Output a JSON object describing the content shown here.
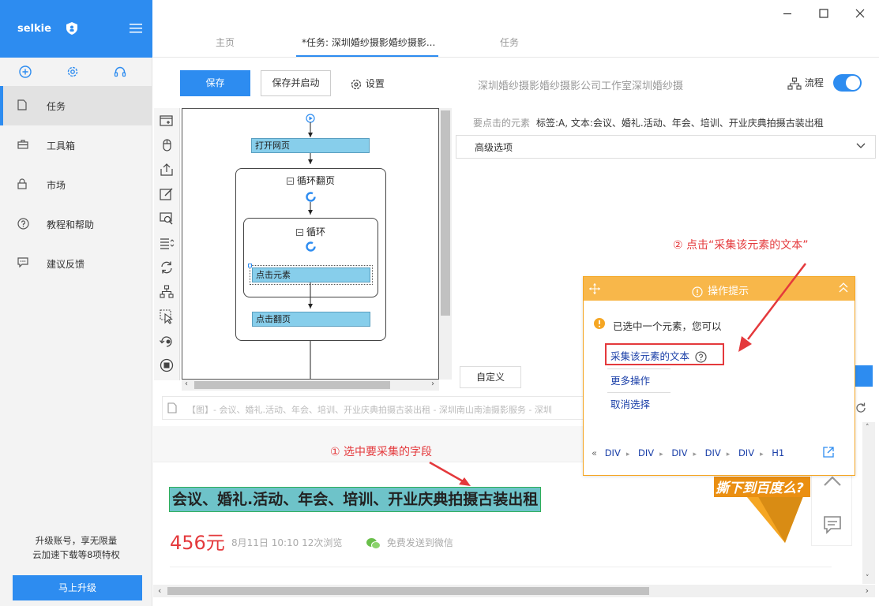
{
  "app": {
    "brand": "selkie"
  },
  "sidebar": {
    "items": [
      {
        "label": "任务",
        "icon": "file-icon",
        "active": true
      },
      {
        "label": "工具箱",
        "icon": "toolbox-icon"
      },
      {
        "label": "市场",
        "icon": "lock-icon"
      },
      {
        "label": "教程和帮助",
        "icon": "help-circle-icon"
      },
      {
        "label": "建议反馈",
        "icon": "feedback-icon"
      }
    ],
    "upgrade_text_1": "升级账号，享无限量",
    "upgrade_text_2": "云加速下载等8项特权",
    "upgrade_button": "马上升级"
  },
  "tabs": [
    {
      "label": "主页"
    },
    {
      "label": "*任务: 深圳婚纱摄影婚纱摄影...",
      "active": true
    },
    {
      "label": "任务"
    }
  ],
  "toolbar": {
    "save": "保存",
    "save_run": "保存并启动",
    "settings": "设置",
    "task_title": "深圳婚纱摄影婚纱摄影公司工作室深圳婚纱摄",
    "flow": "流程",
    "flow_on": true
  },
  "flow": {
    "open_page": "打开网页",
    "loop_page": "循环翻页",
    "loop": "循环",
    "click_element": "点击元素",
    "click_next": "点击翻页"
  },
  "panel": {
    "target_label": "要点击的元素",
    "target_value": "标签:A, 文本:会议、婚礼.活动、年会、培训、开业庆典拍摄古装出租",
    "advanced": "高级选项",
    "custom": "自定义"
  },
  "browser": {
    "address": "【图】- 会议、婚礼.活动、年会、培训、开业庆典拍摄古装出租 - 深圳南山南油摄影服务 - 深圳",
    "headline": "会议、婚礼.活动、年会、培训、开业庆典拍摄古装出租",
    "price": "456元",
    "meta": "8月11日 10:10   12次浏览",
    "wechat": "免费发送到微信",
    "ad_text": "撕下到百度么?"
  },
  "tip": {
    "title": "操作提示",
    "message": "已选中一个元素，您可以",
    "action_collect": "采集该元素的文本",
    "action_more": "更多操作",
    "action_cancel": "取消选择",
    "crumbs": [
      "DIV",
      "DIV",
      "DIV",
      "DIV",
      "DIV",
      "H1"
    ]
  },
  "annotations": {
    "step1": "① 选中要采集的字段",
    "step2": "② 点击“采集该元素的文本”"
  },
  "colors": {
    "primary": "#2d8cf0",
    "tip_header": "#f8b74a",
    "annotation": "#e4393c",
    "node": "#87ceeb"
  }
}
